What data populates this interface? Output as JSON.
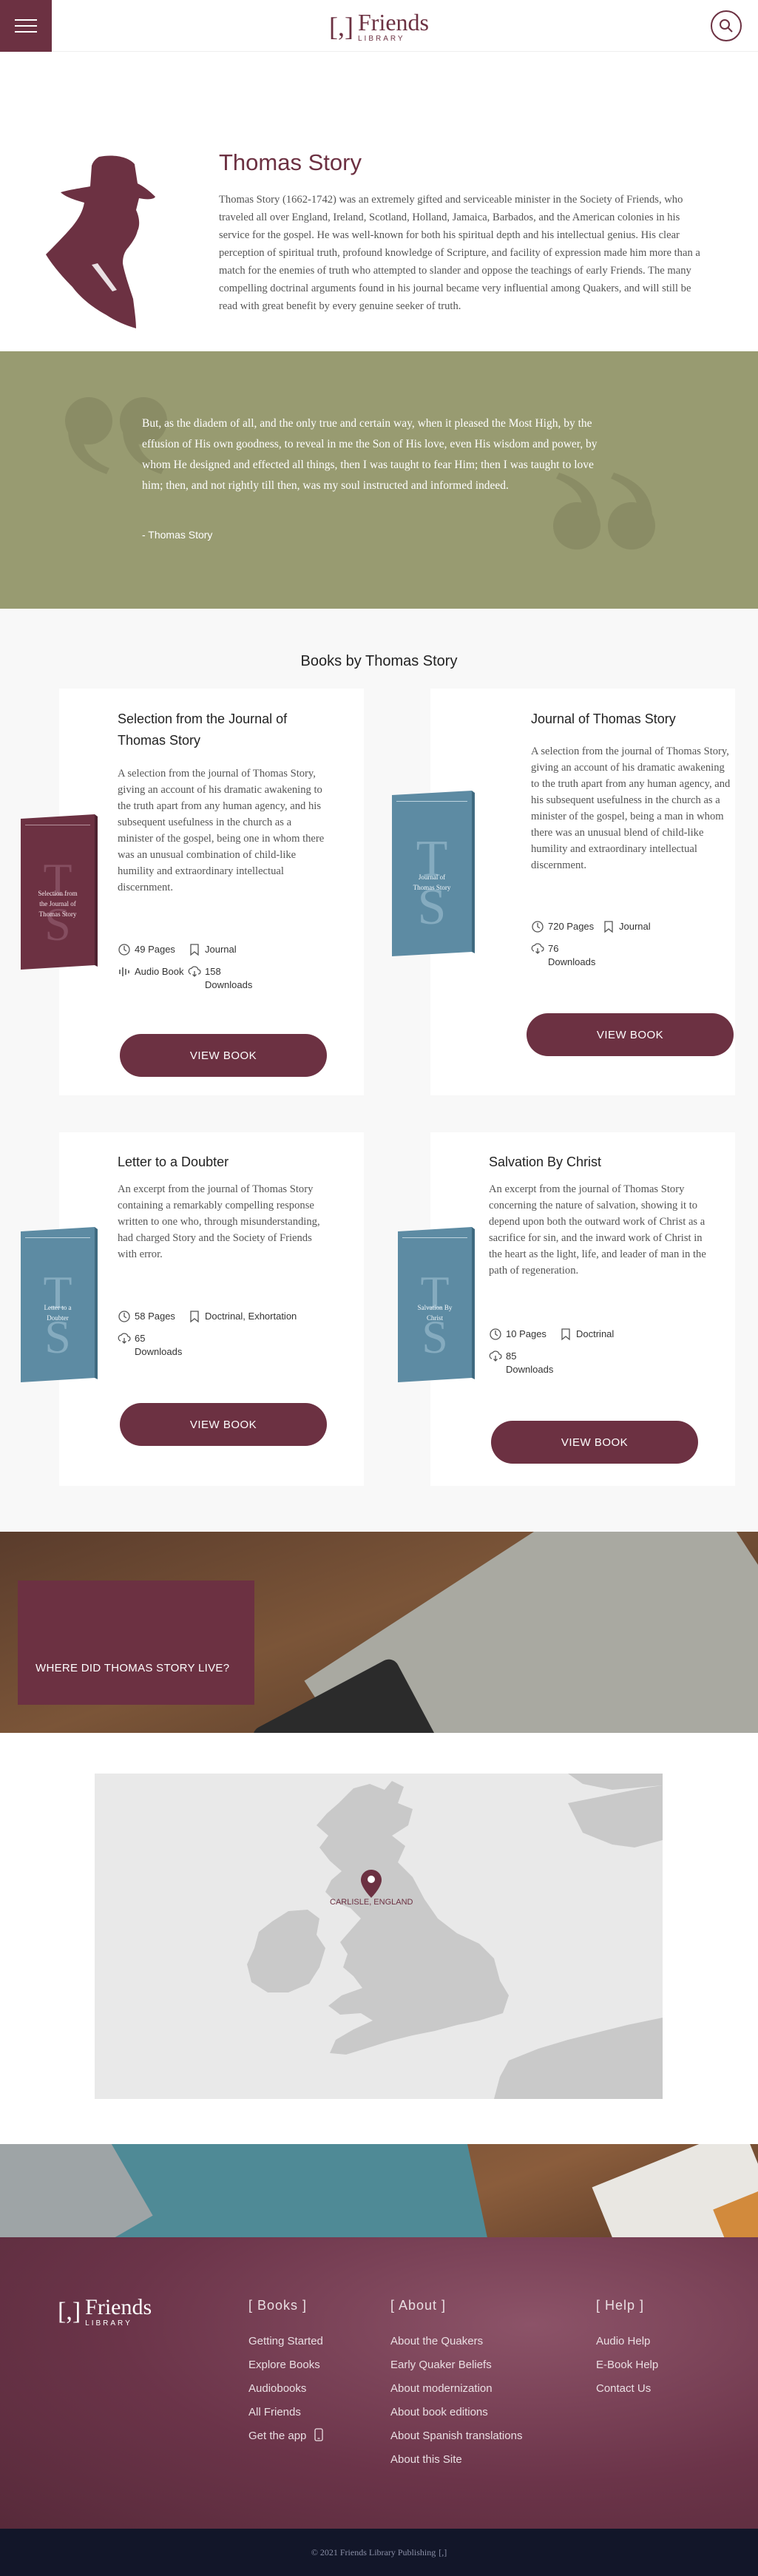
{
  "header": {
    "logo_bracket": "[,]",
    "logo_name": "Friends",
    "logo_sub": "LIBRARY"
  },
  "author": {
    "name": "Thomas Story",
    "bio": "Thomas Story (1662-1742) was an extremely gifted and serviceable minister in the Society of Friends, who traveled all over England, Ireland, Scotland, Holland, Jamaica, Barbados, and the American colonies in his service for the gospel. He was well-known for both his spiritual depth and his intellectual genius. His clear perception of spiritual truth, profound knowledge of Scripture, and facility of expression made him more than a match for the enemies of truth who attempted to slander and oppose the teachings of early Friends. The many compelling doctrinal arguments found in his journal became very influential among Quakers, and will still be read with great benefit by every genuine seeker of truth."
  },
  "quote": {
    "text": "But, as the diadem of all, and the only true and certain way, when it pleased the Most High, by the effusion of His own goodness, to reveal in me the Son of His love, even His wisdom and power, by whom He designed and effected all things, then I was taught to fear Him; then I was taught to love him; then, and not rightly till then, was my soul instructed and informed indeed.",
    "attribution": "- Thomas Story"
  },
  "books": {
    "heading": "Books by Thomas Story",
    "view_label": "VIEW BOOK",
    "items": [
      {
        "title": "Selection from the Journal of Thomas Story",
        "description": "A selection from the journal of Thomas Story, giving an account of his dramatic awakening to the truth apart from any human agency, and his subsequent usefulness in the church as a minister of the gospel, being one in whom there was an unusual combination of child-like humility and extraordinary intellectual discernment.",
        "pages": "49 Pages",
        "tag": "Journal",
        "audio": "Audio Book",
        "downloads": "158",
        "downloads_label": "Downloads",
        "cover_color": "#6c3142",
        "cover_title": "Selection from the Journal of Thomas Story"
      },
      {
        "title": "Journal of Thomas Story",
        "description": "A selection from the journal of Thomas Story, giving an account of his dramatic awakening to the truth apart from any human agency, and his subsequent usefulness in the church as a minister of the gospel, being a man in whom there was an unusual blend of child-like humility and extraordinary intellectual discernment.",
        "pages": "720 Pages",
        "tag": "Journal",
        "downloads": "76",
        "downloads_label": "Downloads",
        "cover_color": "#5d8ba3",
        "cover_title": "Journal of Thomas Story"
      },
      {
        "title": "Letter to a Doubter",
        "description": "An excerpt from the journal of Thomas Story containing a remarkably compelling response written to one who, through misunderstanding, had charged Story and the Society of Friends with error.",
        "pages": "58 Pages",
        "tag": "Doctrinal, Exhortation",
        "downloads": "65",
        "downloads_label": "Downloads",
        "cover_color": "#5d8ba3",
        "cover_title": "Letter to a Doubter"
      },
      {
        "title": "Salvation By Christ",
        "description": "An excerpt from the journal of Thomas Story concerning the nature of salvation, showing it to depend upon both the outward work of Christ as a sacrifice for sin, and the inward work of Christ in the heart as the light, life, and leader of man in the path of regeneration.",
        "pages": "10 Pages",
        "tag": "Doctrinal",
        "downloads": "85",
        "downloads_label": "Downloads",
        "cover_color": "#5d8ba3",
        "cover_title": "Salvation By Christ"
      }
    ]
  },
  "where": {
    "heading": "WHERE DID THOMAS STORY LIVE?"
  },
  "map": {
    "marker_label": "CARLISLE, ENGLAND"
  },
  "footer": {
    "columns": [
      {
        "heading": "[ Books ]",
        "links": [
          "Getting Started",
          "Explore Books",
          "Audiobooks",
          "All Friends",
          "Get the app"
        ]
      },
      {
        "heading": "[ About ]",
        "links": [
          "About the Quakers",
          "Early Quaker Beliefs",
          "About modernization",
          "About book editions",
          "About Spanish translations",
          "About this Site"
        ]
      },
      {
        "heading": "[ Help ]",
        "links": [
          "Audio Help",
          "E-Book Help",
          "Contact Us"
        ]
      }
    ],
    "copyright": "© 2021 Friends Library Publishing",
    "copyright_mark": "[,]"
  },
  "colors": {
    "brand": "#6c3142",
    "quote_bg": "#989b71",
    "book_blue": "#5d8ba3",
    "footer_bottom": "#121629"
  }
}
